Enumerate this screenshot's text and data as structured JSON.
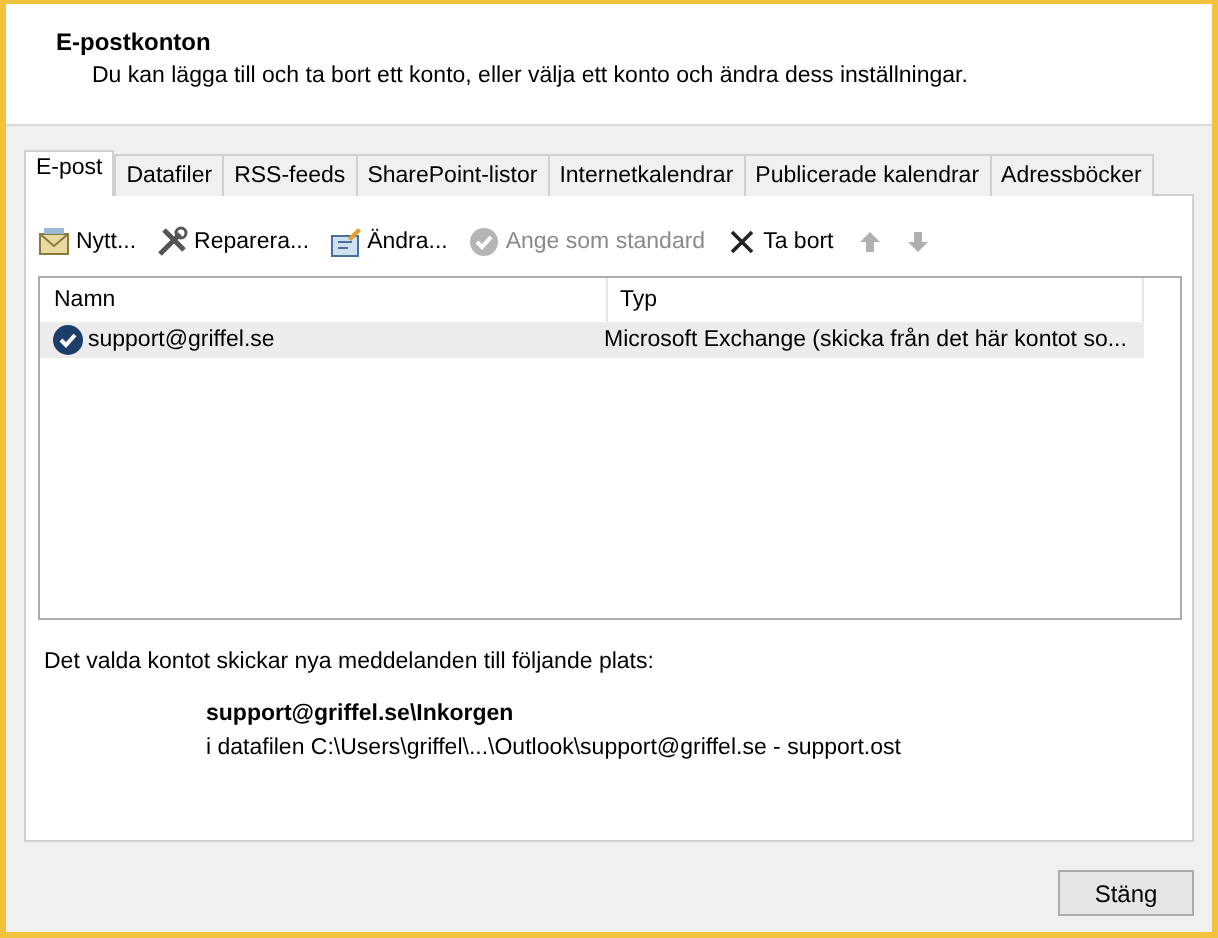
{
  "header": {
    "title": "E-postkonton",
    "subtitle": "Du kan lägga till och ta bort ett konto, eller välja ett konto och ändra dess inställningar."
  },
  "tabs": [
    {
      "label": "E-post",
      "selected": true
    },
    {
      "label": "Datafiler",
      "selected": false
    },
    {
      "label": "RSS-feeds",
      "selected": false
    },
    {
      "label": "SharePoint-listor",
      "selected": false
    },
    {
      "label": "Internetkalendrar",
      "selected": false
    },
    {
      "label": "Publicerade kalendrar",
      "selected": false
    },
    {
      "label": "Adressböcker",
      "selected": false
    }
  ],
  "toolbar": [
    {
      "kind": "new",
      "label": "Nytt...",
      "disabled": false
    },
    {
      "kind": "repair",
      "label": "Reparera...",
      "disabled": false
    },
    {
      "kind": "change",
      "label": "Ändra...",
      "disabled": false
    },
    {
      "kind": "default",
      "label": "Ange som standard",
      "disabled": true
    },
    {
      "kind": "remove",
      "label": "Ta bort",
      "disabled": false
    },
    {
      "kind": "up",
      "disabled": true
    },
    {
      "kind": "down",
      "disabled": true
    }
  ],
  "table": {
    "columns": [
      "Namn",
      "Typ"
    ],
    "rows": [
      {
        "name": "support@griffel.se",
        "type": "Microsoft Exchange (skicka från det här kontot so...",
        "default": true,
        "selected": true
      }
    ]
  },
  "delivery": {
    "intro": "Det valda kontot skickar nya meddelanden till följande plats:",
    "folder": "support@griffel.se\\Inkorgen",
    "datafile": "i datafilen C:\\Users\\griffel\\...\\Outlook\\support@griffel.se - support.ost"
  },
  "close_button": "Stäng"
}
